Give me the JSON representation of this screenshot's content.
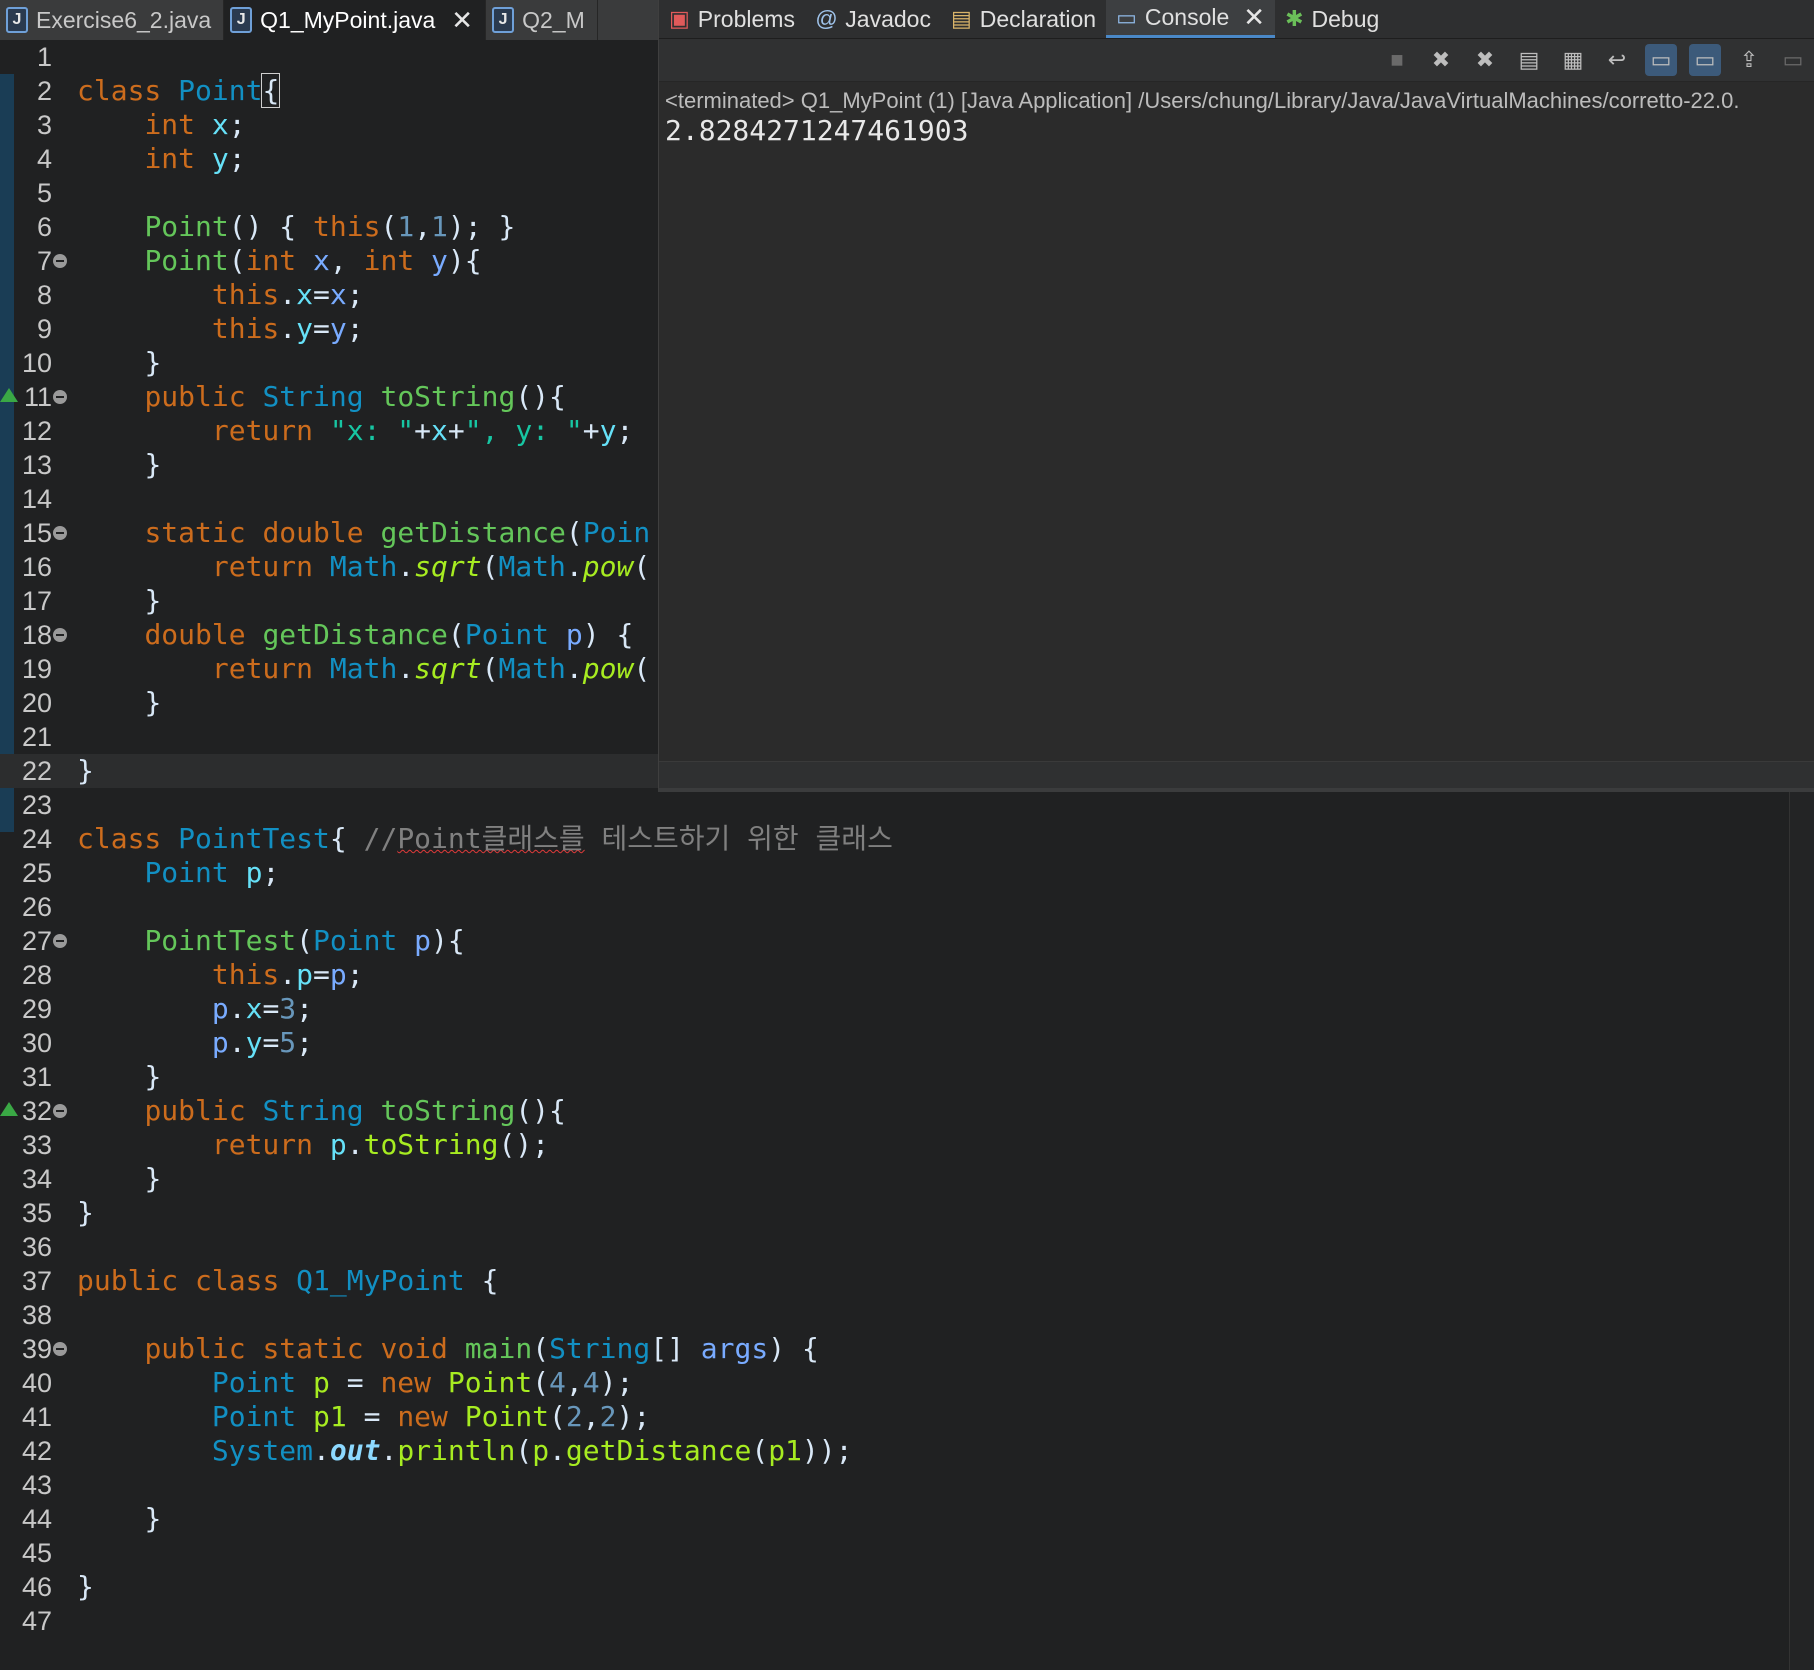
{
  "editor_tabs": [
    {
      "label": "Exercise6_2.java"
    },
    {
      "label": "Q1_MyPoint.java",
      "close": "✕"
    },
    {
      "label": "Q2_M"
    }
  ],
  "view_tabs": [
    {
      "label": "Problems",
      "icon": "problems-icon"
    },
    {
      "label": "Javadoc",
      "icon": "javadoc-icon"
    },
    {
      "label": "Declaration",
      "icon": "declaration-icon"
    },
    {
      "label": "Console",
      "icon": "console-icon",
      "close": "✕"
    },
    {
      "label": "Debug",
      "icon": "debug-icon"
    }
  ],
  "console": {
    "status": "<terminated> Q1_MyPoint (1) [Java Application] /Users/chung/Library/Java/JavaVirtualMachines/corretto-22.0.",
    "output": "2.8284271247461903"
  },
  "lines": {
    "n": [
      "1",
      "2",
      "3",
      "4",
      "5",
      "6",
      "7",
      "8",
      "9",
      "10",
      "11",
      "12",
      "13",
      "14",
      "15",
      "16",
      "17",
      "18",
      "19",
      "20",
      "21",
      "22",
      "23",
      "24",
      "25",
      "26",
      "27",
      "28",
      "29",
      "30",
      "31",
      "32",
      "33",
      "34",
      "35",
      "36",
      "37",
      "38",
      "39",
      "40",
      "41",
      "42",
      "43",
      "44",
      "45",
      "46",
      "47"
    ],
    "c": {
      "l2_0": "class ",
      "l2_1": "Point",
      "l2_2": "{",
      "l3_0": "int ",
      "l3_1": "x",
      "l3_2": ";",
      "l4_0": "int ",
      "l4_1": "y",
      "l4_2": ";",
      "l6_0": "Point",
      "l6_1": "() { ",
      "l6_2": "this",
      "l6_3": "(",
      "l6_4": "1",
      "l6_5": ",",
      "l6_6": "1",
      "l6_7": "); }",
      "l7_0": "Point",
      "l7_1": "(",
      "l7_2": "int ",
      "l7_3": "x",
      "l7_4": ", ",
      "l7_5": "int ",
      "l7_6": "y",
      "l7_7": "){",
      "l8_0": "this",
      "l8_1": ".",
      "l8_2": "x",
      "l8_3": "=",
      "l8_4": "x",
      "l8_5": ";",
      "l9_0": "this",
      "l9_1": ".",
      "l9_2": "y",
      "l9_3": "=",
      "l9_4": "y",
      "l9_5": ";",
      "l10_0": "}",
      "l11_0": "public ",
      "l11_1": "String ",
      "l11_2": "toString",
      "l11_3": "(){",
      "l12_0": "return ",
      "l12_1": "\"x: \"",
      "l12_2": "+",
      "l12_3": "x",
      "l12_4": "+",
      "l12_5": "\", y: \"",
      "l12_6": "+",
      "l12_7": "y",
      "l12_8": ";",
      "l13_0": "}",
      "l15_0": "static ",
      "l15_1": "double ",
      "l15_2": "getDistance",
      "l15_3": "(",
      "l15_4": "Poin",
      "l16_0": "return ",
      "l16_1": "Math",
      "l16_2": ".",
      "l16_3": "sqrt",
      "l16_4": "(",
      "l16_5": "Math",
      "l16_6": ".",
      "l16_7": "pow",
      "l16_8": "(",
      "l17_0": "}",
      "l18_0": "double ",
      "l18_1": "getDistance",
      "l18_2": "(",
      "l18_3": "Point ",
      "l18_4": "p",
      "l18_5": ") {",
      "l19_0": "return ",
      "l19_1": "Math",
      "l19_2": ".",
      "l19_3": "sqrt",
      "l19_4": "(",
      "l19_5": "Math",
      "l19_6": ".",
      "l19_7": "pow",
      "l19_8": "(",
      "l20_0": "}",
      "l22_0": "}",
      "l24_0": "class ",
      "l24_1": "PointTest",
      "l24_2": "{ ",
      "l24_3": "//",
      "l24_4": "Point",
      "l24_5": "클래스를",
      "l24_6": " 테스트하기 위한 클래스",
      "l25_0": "Point ",
      "l25_1": "p",
      "l25_2": ";",
      "l27_0": "PointTest",
      "l27_1": "(",
      "l27_2": "Point ",
      "l27_3": "p",
      "l27_4": "){",
      "l28_0": "this",
      "l28_1": ".",
      "l28_2": "p",
      "l28_3": "=",
      "l28_4": "p",
      "l28_5": ";",
      "l29_0": "p",
      "l29_1": ".",
      "l29_2": "x",
      "l29_3": "=",
      "l29_4": "3",
      "l29_5": ";",
      "l30_0": "p",
      "l30_1": ".",
      "l30_2": "y",
      "l30_3": "=",
      "l30_4": "5",
      "l30_5": ";",
      "l31_0": "}",
      "l32_0": "public ",
      "l32_1": "String ",
      "l32_2": "toString",
      "l32_3": "(){",
      "l33_0": "return ",
      "l33_1": "p",
      "l33_2": ".",
      "l33_3": "toString",
      "l33_4": "();",
      "l34_0": "}",
      "l35_0": "}",
      "l37_0": "public ",
      "l37_1": "class ",
      "l37_2": "Q1_MyPoint",
      "l37_3": " {",
      "l39_0": "public ",
      "l39_1": "static ",
      "l39_2": "void ",
      "l39_3": "main",
      "l39_4": "(",
      "l39_5": "String",
      "l39_6": "[] ",
      "l39_7": "args",
      "l39_8": ") {",
      "l40_0": "Point ",
      "l40_1": "p",
      "l40_2": " = ",
      "l40_3": "new ",
      "l40_4": "Point",
      "l40_5": "(",
      "l40_6": "4",
      "l40_7": ",",
      "l40_8": "4",
      "l40_9": ");",
      "l41_0": "Point ",
      "l41_1": "p1",
      "l41_2": " = ",
      "l41_3": "new ",
      "l41_4": "Point",
      "l41_5": "(",
      "l41_6": "2",
      "l41_7": ",",
      "l41_8": "2",
      "l41_9": ");",
      "l42_0": "System",
      "l42_1": ".",
      "l42_2": "out",
      "l42_3": ".",
      "l42_4": "println",
      "l42_5": "(",
      "l42_6": "p",
      "l42_7": ".",
      "l42_8": "getDistance",
      "l42_9": "(",
      "l42_10": "p1",
      "l42_11": "));",
      "l44_0": "}",
      "l46_0": "}"
    }
  },
  "colors": {
    "keyword": "#cc6c1d",
    "type": "#1290c3",
    "method": "#a7ec21",
    "number": "#6897bb",
    "string": "#17c6a3",
    "comment": "#808080",
    "active_tab_underline": "#4a88c7"
  }
}
